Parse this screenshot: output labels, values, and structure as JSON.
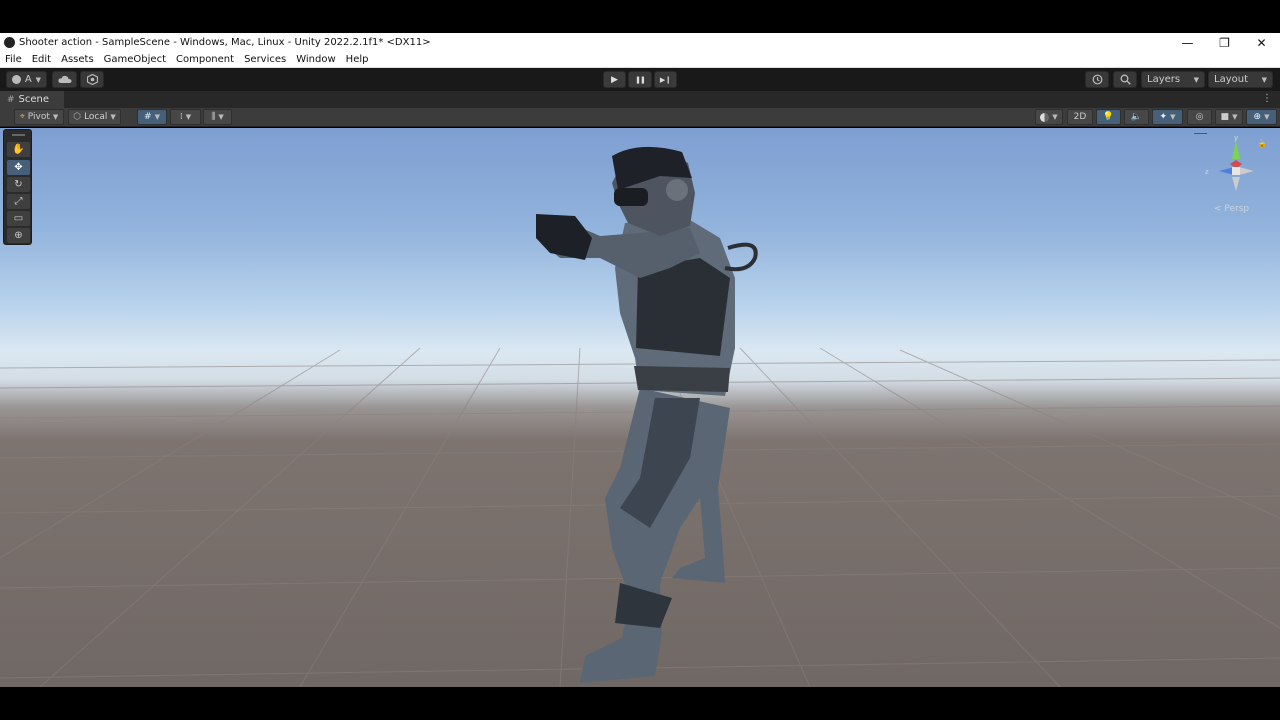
{
  "window": {
    "title": "Shooter action - SampleScene - Windows, Mac, Linux - Unity 2022.2.1f1* <DX11>",
    "controls": [
      "—",
      "❐",
      "✕"
    ]
  },
  "menu": [
    "File",
    "Edit",
    "Assets",
    "GameObject",
    "Component",
    "Services",
    "Window",
    "Help"
  ],
  "toolbar": {
    "account_label": "A",
    "layers_label": "Layers",
    "layout_label": "Layout",
    "play_icon": "▶",
    "pause_icon": "❚❚",
    "step_icon": "▶❙"
  },
  "scene_tab": {
    "label": "Scene",
    "icon": "#"
  },
  "scene_toolbar": {
    "pivot_label": "Pivot",
    "local_label": "Local",
    "mode_2d_label": "2D"
  },
  "tools": [
    "✋",
    "✥",
    "↻",
    "⤢",
    "▭",
    "⊕"
  ],
  "gizmo": {
    "axis_y": "y",
    "axis_z": "z",
    "projection_label": "< Persp"
  },
  "icons": {
    "unity_logo": "unity-logo-icon",
    "cloud": "cloud-icon",
    "collab": "collab-icon",
    "history": "history-icon",
    "search": "search-icon"
  }
}
